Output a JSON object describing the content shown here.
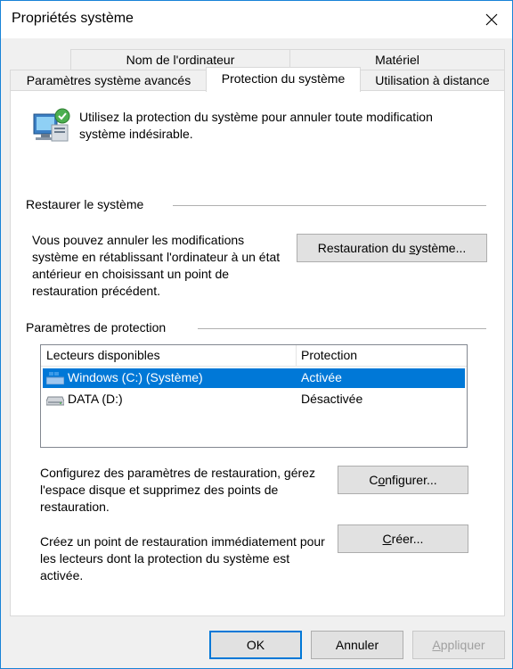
{
  "window": {
    "title": "Propriétés système"
  },
  "tabs": {
    "row1": [
      {
        "label": "Nom de l'ordinateur"
      },
      {
        "label": "Matériel"
      }
    ],
    "row2": [
      {
        "label": "Paramètres système avancés"
      },
      {
        "label": "Protection du système"
      },
      {
        "label": "Utilisation à distance"
      }
    ],
    "active": "Protection du système"
  },
  "intro": {
    "text": "Utilisez la protection du système pour annuler toute modification système indésirable."
  },
  "restore": {
    "group_title": "Restaurer le système",
    "description": "Vous pouvez annuler les modifications système en rétablissant l'ordinateur à un état antérieur en choisissant un point de restauration précédent.",
    "button_pre": "Restauration du ",
    "button_u": "s",
    "button_post": "ystème..."
  },
  "protection": {
    "group_title": "Paramètres de protection",
    "columns": [
      "Lecteurs disponibles",
      "Protection"
    ],
    "drives": [
      {
        "name": "Windows (C:) (Système)",
        "status": "Activée",
        "icon": "windows-drive-icon",
        "selected": true
      },
      {
        "name": "DATA (D:)",
        "status": "Désactivée",
        "icon": "hard-drive-icon",
        "selected": false
      }
    ],
    "configure_text": "Configurez des paramètres de restauration, gérez l'espace disque et supprimez des points de restauration.",
    "configure_pre": "C",
    "configure_u": "o",
    "configure_post": "nfigurer...",
    "create_text": "Créez un point de restauration immédiatement pour les lecteurs dont la protection du système est activée.",
    "create_pre": "",
    "create_u": "C",
    "create_post": "réer..."
  },
  "footer": {
    "ok": "OK",
    "cancel": "Annuler",
    "apply_pre": "",
    "apply_u": "A",
    "apply_post": "ppliquer"
  },
  "colors": {
    "accent": "#0078d7",
    "border": "#1883d7"
  }
}
